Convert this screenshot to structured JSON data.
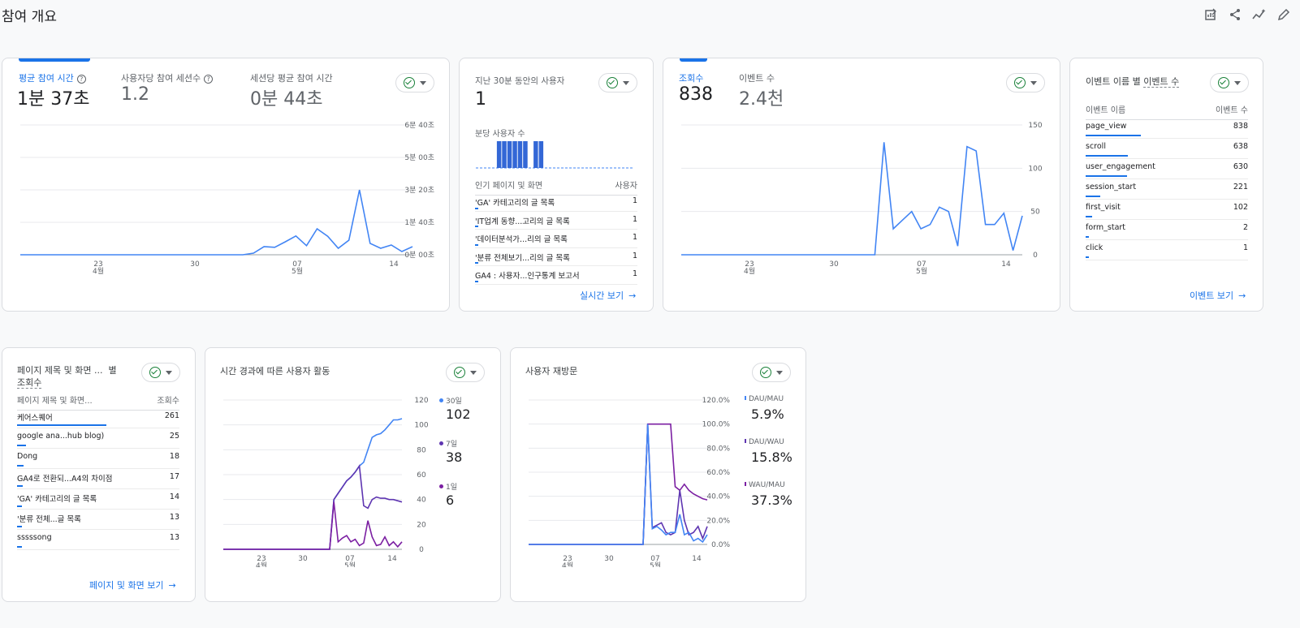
{
  "page": {
    "title": "참여 개요"
  },
  "colors": {
    "accent": "#1a73e8",
    "line": "#4285f4",
    "line2": "#5e35b1",
    "line3": "#7b1fa2",
    "ok": "#188038"
  },
  "card1": {
    "metrics": [
      {
        "label": "평균 참여 시간",
        "value": "1분 37초"
      },
      {
        "label": "사용자당 참여 세션수",
        "value": "1.2"
      },
      {
        "label": "세션당 평균 참여 시간",
        "value": "0분 44초"
      }
    ],
    "y_ticks": [
      "6분 40초",
      "5분 00초",
      "3분 20초",
      "1분 40초",
      "0분 00초"
    ],
    "x_ticks": [
      "23",
      "4월",
      "30",
      "07",
      "5월",
      "14"
    ]
  },
  "card2": {
    "title": "지난 30분 동안의 사용자",
    "value": "1",
    "per_minute_label": "분당 사용자 수",
    "table_headers": [
      "인기 페이지 및 화면",
      "사용자"
    ],
    "rows": [
      {
        "name": "'GA' 카테고리의 글 목록",
        "value": "1"
      },
      {
        "name": "'IT업계 동향...고리의 글 목록",
        "value": "1"
      },
      {
        "name": "'데이터분석가...리의 글 목록",
        "value": "1"
      },
      {
        "name": "'분류 전체보기...리의 글 목록",
        "value": "1"
      },
      {
        "name": "GA4 : 사용자...인구통계 보고서",
        "value": "1"
      }
    ],
    "link": "실시간 보기"
  },
  "card3": {
    "metrics": [
      {
        "label": "조회수",
        "value": "838"
      },
      {
        "label": "이벤트 수",
        "value": "2.4천"
      }
    ],
    "y_ticks": [
      "150",
      "100",
      "50",
      "0"
    ],
    "x_ticks": [
      "23",
      "4월",
      "30",
      "07",
      "5월",
      "14"
    ]
  },
  "card4": {
    "title_a": "이벤트 이름",
    "title_b": "별",
    "title_c": "이벤트 수",
    "table_headers": [
      "이벤트 이름",
      "이벤트 수"
    ],
    "rows": [
      {
        "name": "page_view",
        "value": "838",
        "frac": 1.0
      },
      {
        "name": "scroll",
        "value": "638",
        "frac": 0.761
      },
      {
        "name": "user_engagement",
        "value": "630",
        "frac": 0.752
      },
      {
        "name": "session_start",
        "value": "221",
        "frac": 0.264
      },
      {
        "name": "first_visit",
        "value": "102",
        "frac": 0.122
      },
      {
        "name": "form_start",
        "value": "2",
        "frac": 0.002
      },
      {
        "name": "click",
        "value": "1",
        "frac": 0.001
      }
    ],
    "link": "이벤트 보기"
  },
  "card5": {
    "title_a": "페이지 제목 및 화면 ...",
    "title_b": "별",
    "title_c": "조회수",
    "table_headers": [
      "페이지 제목 및 화면...",
      "조회수"
    ],
    "rows": [
      {
        "name": "케어스퀘어",
        "value": "261",
        "frac": 1.0
      },
      {
        "name": "google ana...hub blog)",
        "value": "25",
        "frac": 0.096
      },
      {
        "name": "Dong",
        "value": "18",
        "frac": 0.069
      },
      {
        "name": "GA4로 전환되...A4의 차이점",
        "value": "17",
        "frac": 0.065
      },
      {
        "name": "'GA' 카테고리의 글 목록",
        "value": "14",
        "frac": 0.054
      },
      {
        "name": "'분류 전체...글 목록",
        "value": "13",
        "frac": 0.05
      },
      {
        "name": "sssssong",
        "value": "13",
        "frac": 0.05
      }
    ],
    "link": "페이지 및 화면 보기"
  },
  "card6": {
    "title": "시간 경과에 따른 사용자 활동",
    "y_ticks": [
      "120",
      "100",
      "80",
      "60",
      "40",
      "20",
      "0"
    ],
    "x_ticks": [
      "23",
      "4월",
      "30",
      "07",
      "5월",
      "14"
    ],
    "legend": [
      {
        "label": "30일",
        "value": "102"
      },
      {
        "label": "7일",
        "value": "38"
      },
      {
        "label": "1일",
        "value": "6"
      }
    ]
  },
  "card7": {
    "title": "사용자 재방문",
    "y_ticks": [
      "120.0%",
      "100.0%",
      "80.0%",
      "60.0%",
      "40.0%",
      "20.0%",
      "0.0%"
    ],
    "x_ticks": [
      "23",
      "4월",
      "30",
      "07",
      "5월",
      "14"
    ],
    "legend": [
      {
        "label": "DAU/MAU",
        "value": "5.9%"
      },
      {
        "label": "DAU/WAU",
        "value": "15.8%"
      },
      {
        "label": "WAU/MAU",
        "value": "37.3%"
      }
    ]
  },
  "chart_data": [
    {
      "type": "line",
      "y_unit": "seconds",
      "ylim": [
        0,
        400
      ],
      "values": [
        0,
        0,
        0,
        0,
        0,
        0,
        0,
        0,
        0,
        0,
        0,
        0,
        0,
        0,
        0,
        0,
        0,
        0,
        0,
        0,
        0,
        0,
        5,
        25,
        23,
        40,
        58,
        28,
        80,
        57,
        20,
        45,
        200,
        35,
        20,
        30,
        10,
        25
      ]
    },
    {
      "type": "line",
      "ylim": [
        0,
        150
      ],
      "values": [
        0,
        0,
        0,
        0,
        0,
        0,
        0,
        0,
        0,
        0,
        0,
        0,
        0,
        0,
        0,
        0,
        0,
        0,
        0,
        0,
        0,
        0,
        130,
        30,
        40,
        50,
        30,
        35,
        55,
        50,
        10,
        125,
        120,
        35,
        35,
        48,
        5,
        45
      ]
    },
    {
      "type": "bar",
      "title": "분당 사용자 수",
      "values": [
        0,
        0,
        0,
        0,
        1,
        1,
        1,
        1,
        1,
        1,
        0,
        1,
        1,
        0,
        0,
        0,
        0,
        0,
        0,
        0,
        0,
        0,
        0,
        0,
        0,
        0,
        0,
        0,
        0,
        0
      ]
    },
    {
      "type": "line",
      "ylim": [
        0,
        120
      ],
      "x": [
        "23",
        "30",
        "07",
        "14"
      ],
      "series": [
        {
          "name": "30일",
          "values": [
            0,
            0,
            0,
            0,
            0,
            0,
            0,
            0,
            0,
            0,
            0,
            0,
            0,
            0,
            0,
            0,
            0,
            0,
            0,
            0,
            0,
            0,
            0,
            0,
            0,
            0,
            40,
            45,
            50,
            55,
            58,
            62,
            67,
            70,
            80,
            90,
            92,
            93,
            96,
            100,
            104,
            104,
            105
          ]
        },
        {
          "name": "7일",
          "values": [
            0,
            0,
            0,
            0,
            0,
            0,
            0,
            0,
            0,
            0,
            0,
            0,
            0,
            0,
            0,
            0,
            0,
            0,
            0,
            0,
            0,
            0,
            0,
            0,
            0,
            0,
            40,
            45,
            50,
            55,
            58,
            62,
            67,
            35,
            33,
            40,
            42,
            41,
            41,
            40,
            40,
            39,
            38
          ]
        },
        {
          "name": "1일",
          "values": [
            0,
            0,
            0,
            0,
            0,
            0,
            0,
            0,
            0,
            0,
            0,
            0,
            0,
            0,
            0,
            0,
            0,
            0,
            0,
            0,
            0,
            0,
            0,
            0,
            0,
            0,
            38,
            6,
            9,
            11,
            6,
            8,
            3,
            5,
            23,
            10,
            3,
            4,
            10,
            3,
            6,
            2,
            6
          ]
        }
      ]
    },
    {
      "type": "line",
      "y_unit": "%",
      "ylim": [
        0,
        120
      ],
      "x": [
        "23",
        "30",
        "07",
        "14"
      ],
      "series": [
        {
          "name": "DAU/MAU",
          "values": [
            0,
            0,
            0,
            0,
            0,
            0,
            0,
            0,
            0,
            0,
            0,
            0,
            0,
            0,
            0,
            0,
            0,
            0,
            0,
            0,
            0,
            0,
            0,
            0,
            0,
            0,
            100,
            13,
            15,
            12,
            8,
            10,
            10,
            25,
            8,
            10,
            3,
            5,
            2,
            8
          ]
        },
        {
          "name": "DAU/WAU",
          "values": [
            0,
            0,
            0,
            0,
            0,
            0,
            0,
            0,
            0,
            0,
            0,
            0,
            0,
            0,
            0,
            0,
            0,
            0,
            0,
            0,
            0,
            0,
            0,
            0,
            0,
            0,
            100,
            14,
            16,
            18,
            10,
            8,
            10,
            45,
            20,
            8,
            10,
            15,
            5,
            15
          ]
        },
        {
          "name": "WAU/MAU",
          "values": [
            0,
            0,
            0,
            0,
            0,
            0,
            0,
            0,
            0,
            0,
            0,
            0,
            0,
            0,
            0,
            0,
            0,
            0,
            0,
            0,
            0,
            0,
            0,
            0,
            0,
            0,
            100,
            100,
            100,
            100,
            100,
            100,
            48,
            45,
            50,
            45,
            42,
            40,
            38,
            37
          ]
        }
      ]
    }
  ]
}
